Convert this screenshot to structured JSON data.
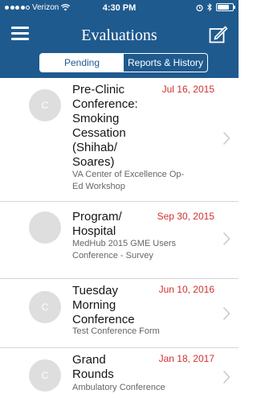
{
  "status_bar": {
    "carrier": "Verizon",
    "time": "4:30 PM"
  },
  "nav": {
    "title": "Evaluations"
  },
  "segments": [
    {
      "label": "Pending",
      "active": true
    },
    {
      "label": "Reports & History",
      "active": false
    }
  ],
  "evaluations": [
    {
      "avatar_initial": "C",
      "title": [
        "Pre-Clinic",
        "Conference:",
        "Smoking",
        "Cessation",
        "(Shihab/",
        "Soares)"
      ],
      "date": "Jul 16, 2015",
      "subtitle": [
        "VA Center of Excellence Op-",
        "Ed Workshop"
      ]
    },
    {
      "avatar_initial": "",
      "title": [
        "Program/",
        "Hospital"
      ],
      "date": "Sep 30, 2015",
      "subtitle": [
        "MedHub 2015 GME Users",
        "Conference - Survey"
      ]
    },
    {
      "avatar_initial": "C",
      "title": [
        "Tuesday",
        "Morning",
        "Conference"
      ],
      "date": "Jun 10, 2016",
      "subtitle": [
        "Test Conference Form"
      ]
    },
    {
      "avatar_initial": "C",
      "title": [
        "Grand",
        "Rounds"
      ],
      "date": "Jan 18, 2017",
      "subtitle": [
        "Ambulatory Conference"
      ]
    }
  ],
  "colors": {
    "header": "#1f5a8e",
    "date": "#d0302f"
  }
}
